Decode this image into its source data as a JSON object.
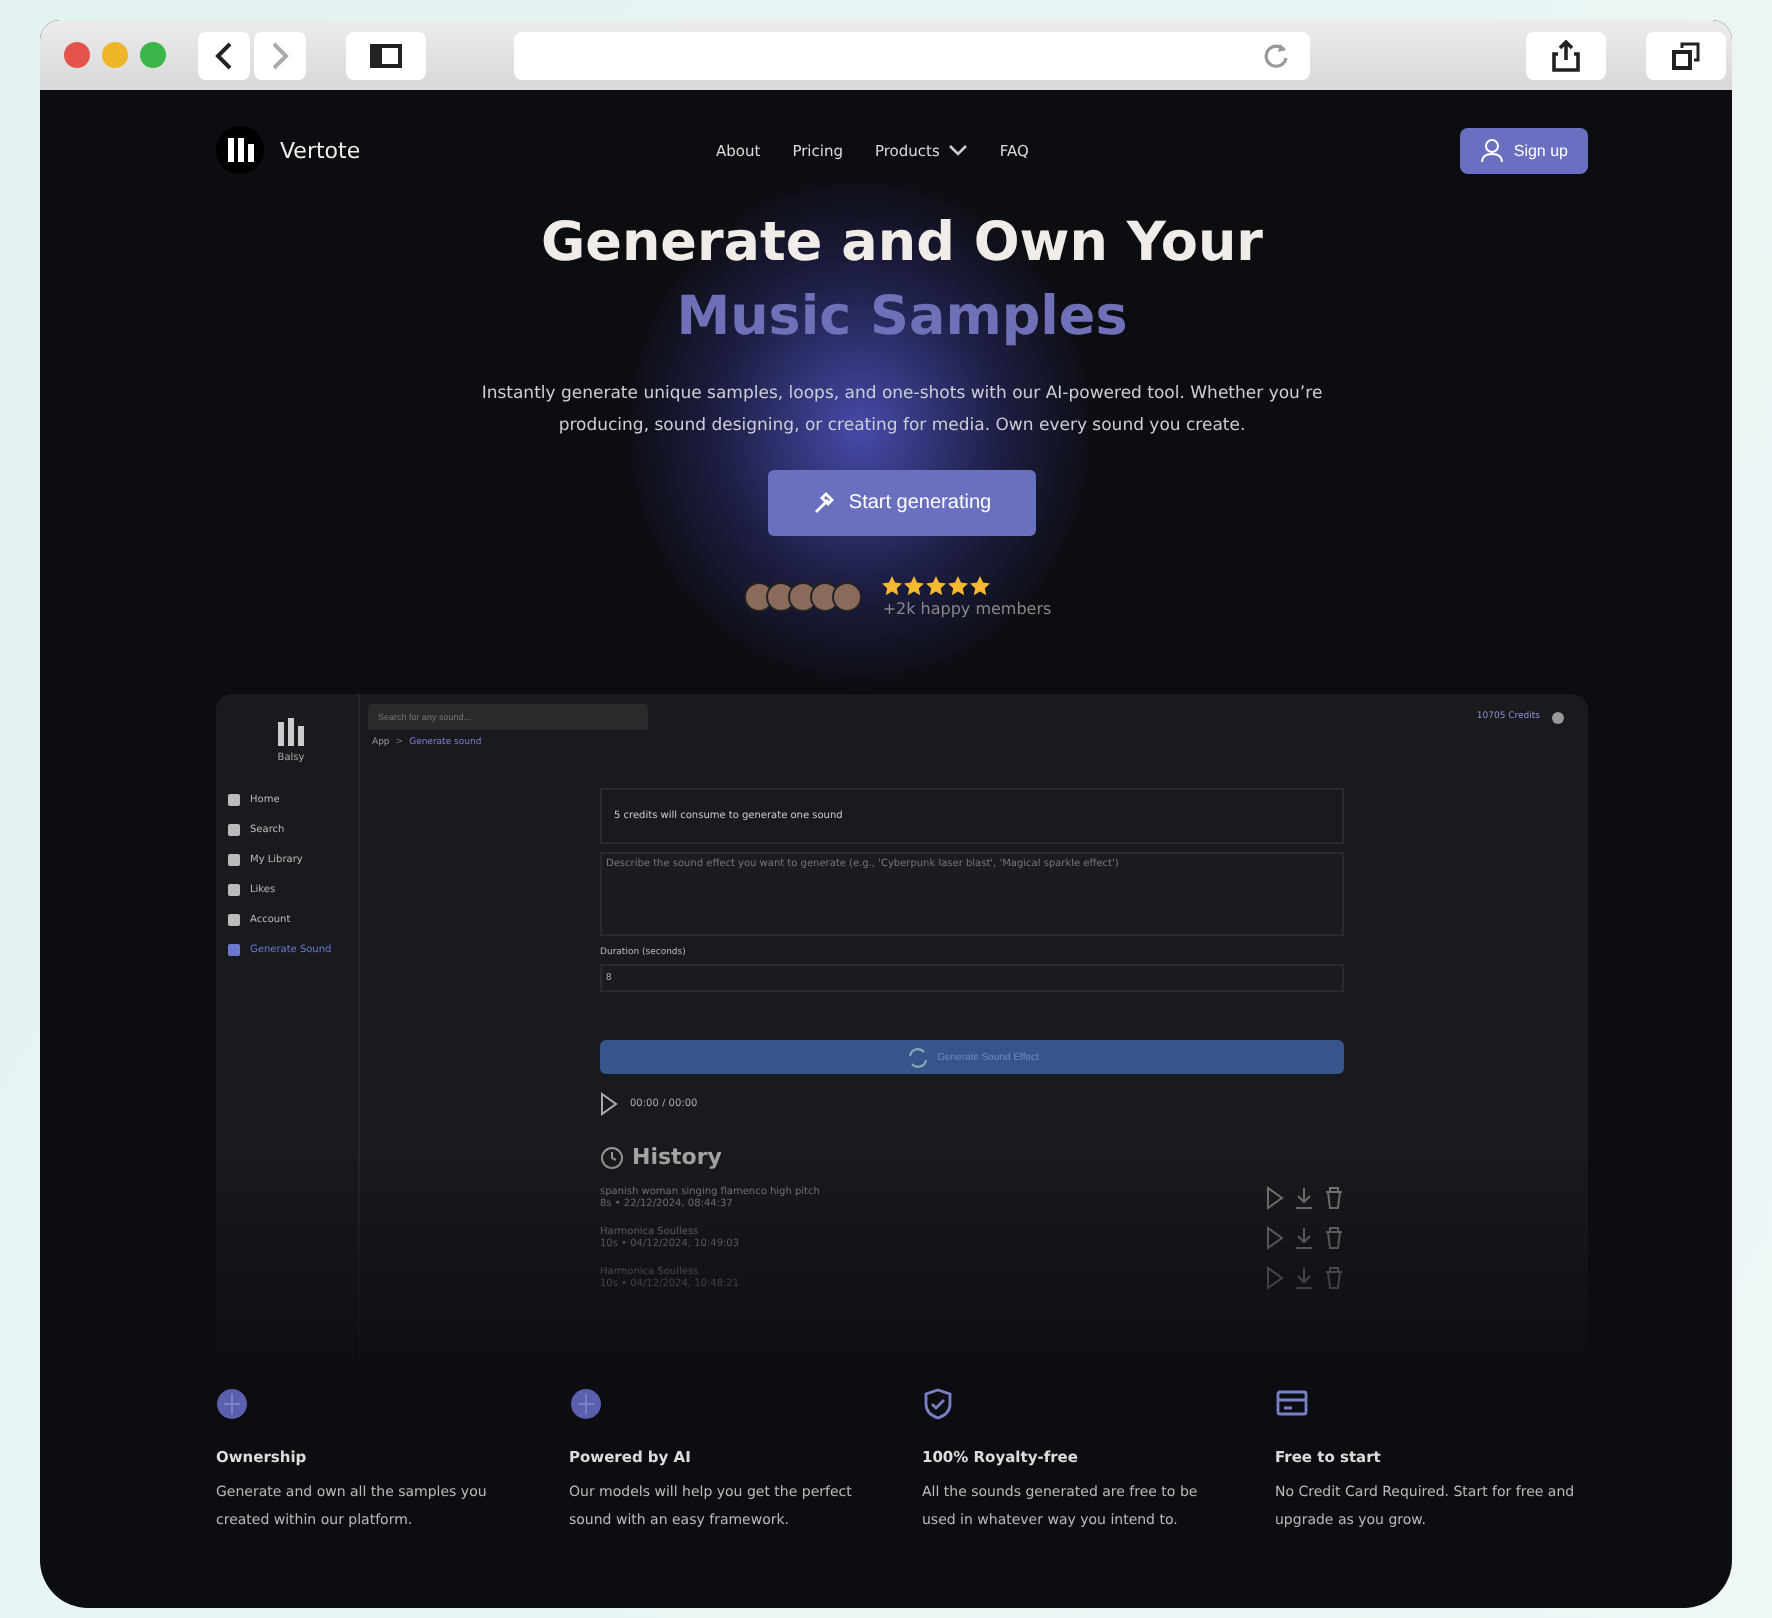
{
  "nav": {
    "brand": "Vertote",
    "links": [
      {
        "label": "About",
        "dropdown": false
      },
      {
        "label": "Pricing",
        "dropdown": false
      },
      {
        "label": "Products",
        "dropdown": true
      },
      {
        "label": "FAQ",
        "dropdown": false
      }
    ],
    "signup": "Sign up"
  },
  "hero": {
    "title": "Generate and Own Your",
    "title_accent": "Music Samples",
    "subtitle": "Instantly generate unique samples, loops, and one-shots with our AI-powered tool. Whether you’re producing, sound designing, or creating for media. Own every sound you create.",
    "cta": "Start generating",
    "stars": 5,
    "members": "+2k happy members"
  },
  "app": {
    "brand": "Balsy",
    "search_placeholder": "Search for any sound...",
    "credits": "10705 Credits",
    "sidebar": [
      {
        "label": "Home",
        "selected": false
      },
      {
        "label": "Search",
        "selected": false
      },
      {
        "label": "My Library",
        "selected": false
      },
      {
        "label": "Likes",
        "selected": false
      },
      {
        "label": "Account",
        "selected": false
      },
      {
        "label": "Generate Sound",
        "selected": true
      }
    ],
    "breadcrumb": [
      "App",
      "Generate sound"
    ],
    "breadcrumb_separator": ">",
    "notice": "5 credits will consume to generate one sound",
    "prompt_placeholder": "Describe the sound effect you want to generate (e.g., 'Cyberpunk laser blast', 'Magical sparkle effect')",
    "duration_label": "Duration (seconds)",
    "duration_value": "8",
    "generate": "Generate Sound Effect",
    "time": "00:00 / 00:00",
    "history_title": "History",
    "history": [
      {
        "title": "spanish woman singing flamenco high pitch",
        "meta": "8s • 22/12/2024, 08:44:37"
      },
      {
        "title": "Harmonica Soulless",
        "meta": "10s • 04/12/2024, 10:49:03"
      },
      {
        "title": "Harmonica Soulless",
        "meta": "10s • 04/12/2024, 10:48:21"
      }
    ]
  },
  "features": [
    {
      "kind": "globe",
      "title": "Ownership",
      "text": "Generate and own all the samples you created within our platform."
    },
    {
      "kind": "globe",
      "title": "Powered by AI",
      "text": "Our models will help you get the perfect sound with an easy framework."
    },
    {
      "kind": "shield",
      "title": "100% Royalty-free",
      "text": "All the sounds generated are free to be used in whatever way you intend to."
    },
    {
      "kind": "card",
      "title": "Free to start",
      "text": "No Credit Card Required. Start for free and upgrade as you grow."
    }
  ]
}
